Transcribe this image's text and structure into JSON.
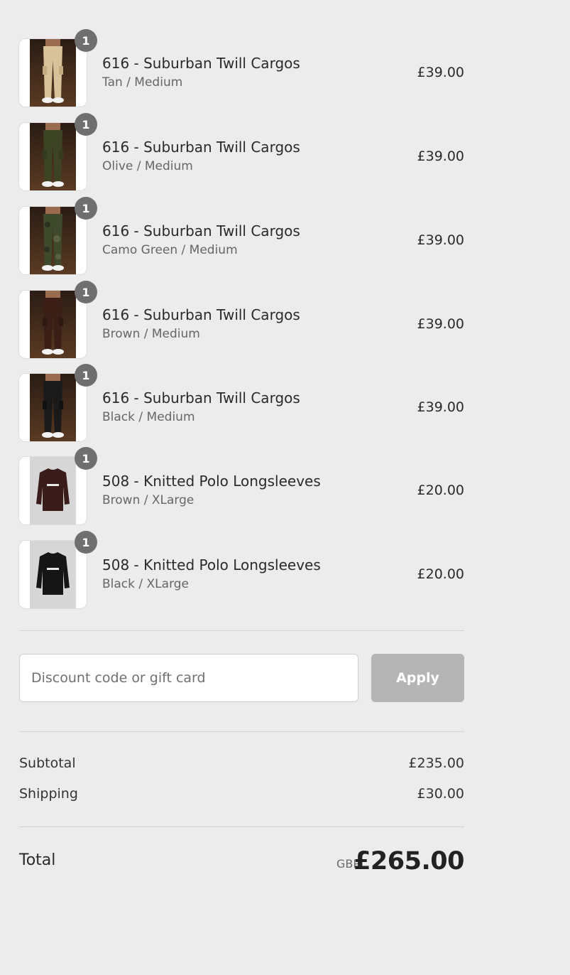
{
  "line_items": [
    {
      "name": "616 - Suburban Twill Cargos",
      "variant": "Tan / Medium",
      "price": "£39.00",
      "quantity": "1",
      "image": "cargo-pants-tan",
      "color": "#d8c29a"
    },
    {
      "name": "616 - Suburban Twill Cargos",
      "variant": "Olive / Medium",
      "price": "£39.00",
      "quantity": "1",
      "image": "cargo-pants-olive",
      "color": "#3d4424"
    },
    {
      "name": "616 - Suburban Twill Cargos",
      "variant": "Camo Green / Medium",
      "price": "£39.00",
      "quantity": "1",
      "image": "cargo-pants-camo",
      "color": "#3f4a2c"
    },
    {
      "name": "616 - Suburban Twill Cargos",
      "variant": "Brown / Medium",
      "price": "£39.00",
      "quantity": "1",
      "image": "cargo-pants-brown",
      "color": "#3b1f17"
    },
    {
      "name": "616 - Suburban Twill Cargos",
      "variant": "Black / Medium",
      "price": "£39.00",
      "quantity": "1",
      "image": "cargo-pants-black",
      "color": "#1a1a1a"
    },
    {
      "name": "508 - Knitted Polo Longsleeves",
      "variant": "Brown / XLarge",
      "price": "£20.00",
      "quantity": "1",
      "image": "longsleeve-brown",
      "color": "#3a1c1a"
    },
    {
      "name": "508 - Knitted Polo Longsleeves",
      "variant": "Black / XLarge",
      "price": "£20.00",
      "quantity": "1",
      "image": "longsleeve-black",
      "color": "#151515"
    }
  ],
  "discount": {
    "placeholder": "Discount code or gift card",
    "value": "",
    "apply_label": "Apply"
  },
  "totals": {
    "subtotal_label": "Subtotal",
    "subtotal_value": "£235.00",
    "shipping_label": "Shipping",
    "shipping_value": "£30.00",
    "total_label": "Total",
    "currency": "GBP",
    "total_value": "£265.00"
  },
  "colors": {
    "background": "#ececec",
    "badge": "#6f6f6f",
    "apply_button_disabled": "#b5b5b5"
  }
}
